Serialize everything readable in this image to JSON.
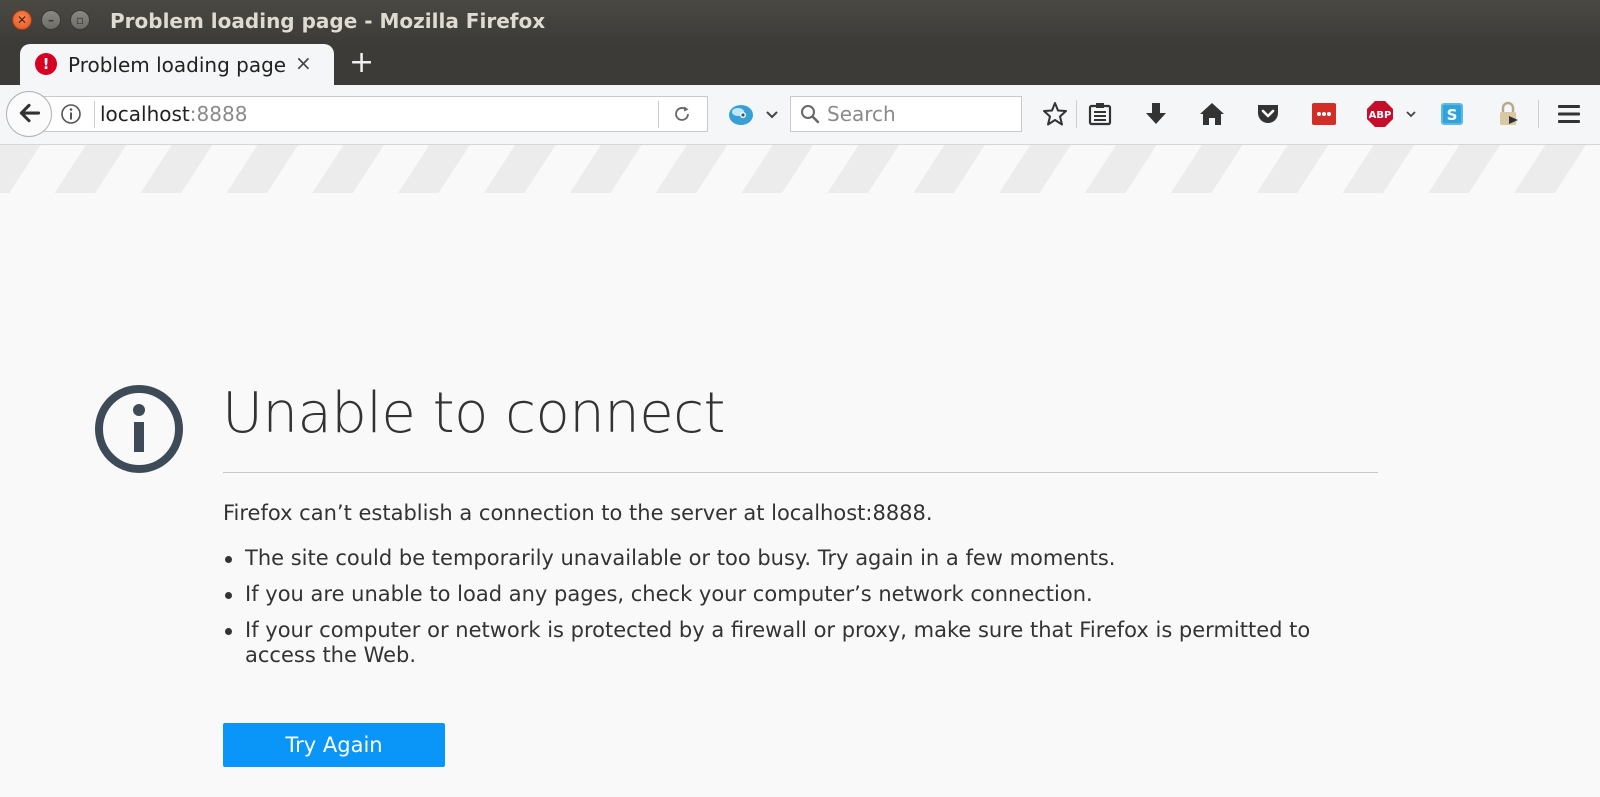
{
  "window": {
    "title": "Problem loading page - Mozilla Firefox"
  },
  "tabs": [
    {
      "title": "Problem loading page",
      "close_glyph": "×",
      "icon": "error-icon"
    }
  ],
  "new_tab_glyph": "+",
  "urlbar": {
    "host": "localhost",
    "port": ":8888"
  },
  "search": {
    "placeholder": "Search"
  },
  "toolbar_icons": [
    "bookmark-star-icon",
    "reading-list-icon",
    "download-icon",
    "home-icon",
    "pocket-icon",
    "lastpass-icon",
    "adblock-plus-icon",
    "skype-icon",
    "lock-extension-icon",
    "hamburger-menu-icon"
  ],
  "error": {
    "title": "Unable to connect",
    "description": "Firefox can’t establish a connection to the server at localhost:8888.",
    "bullets": [
      "The site could be temporarily unavailable or too busy. Try again in a few moments.",
      "If you are unable to load any pages, check your computer’s network connection.",
      "If your computer or network is protected by a firewall or proxy, make sure that Firefox is permitted to access the Web."
    ],
    "button_label": "Try Again"
  },
  "extensions": {
    "adblock_label": "ABP"
  },
  "colors": {
    "accent": "#0996f8",
    "error_red": "#d70022",
    "text": "#333333"
  }
}
